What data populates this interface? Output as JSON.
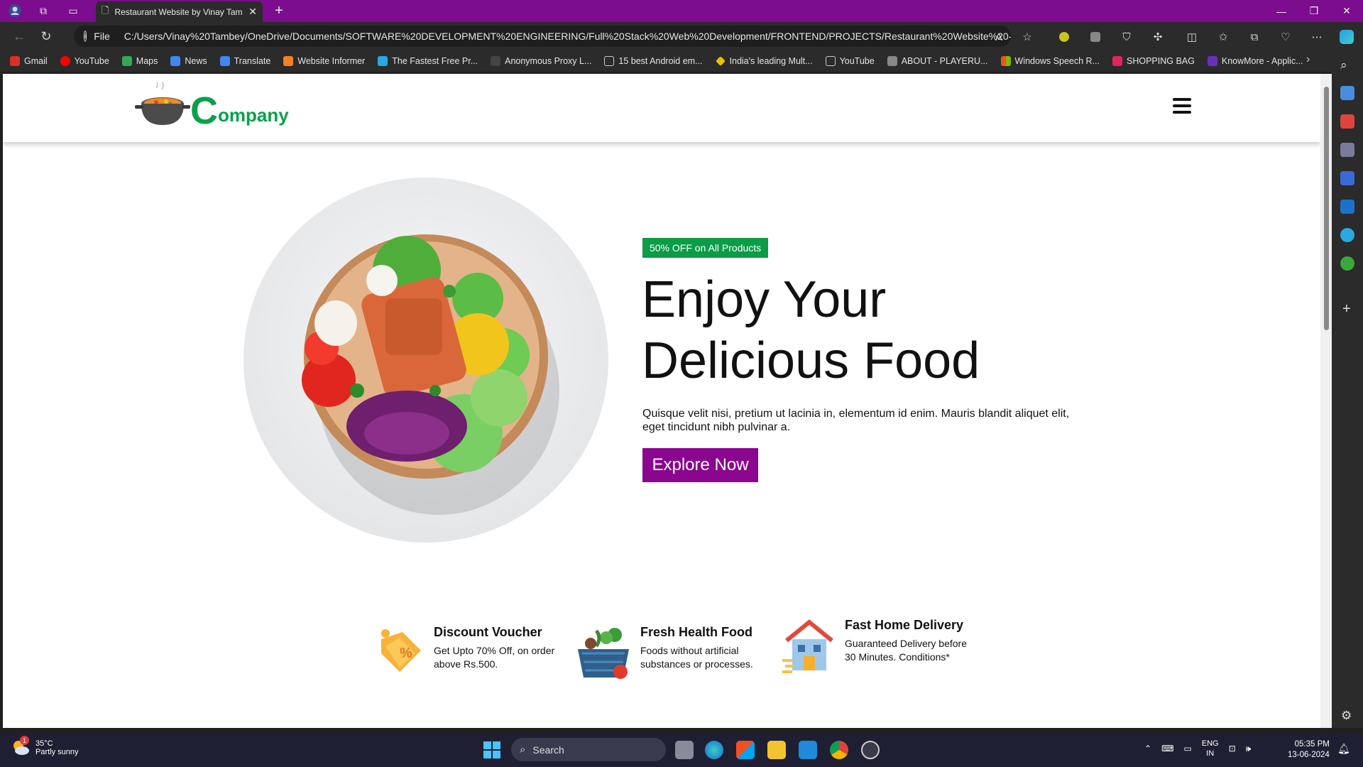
{
  "browser": {
    "tab_title": "Restaurant Website by Vinay Tam",
    "url_scheme": "File",
    "url": "C:/Users/Vinay%20Tambey/OneDrive/Documents/SOFTWARE%20DEVELOPMENT%20ENGINEERING/Full%20Stack%20Web%20Development/FRONTEND/PROJECTS/Restaurant%20Website%20-...",
    "bookmarks": [
      {
        "label": "Gmail",
        "color": "#d93025"
      },
      {
        "label": "YouTube",
        "color": "#ff0000"
      },
      {
        "label": "Maps",
        "color": "#34a853"
      },
      {
        "label": "News",
        "color": "#4285f4"
      },
      {
        "label": "Translate",
        "color": "#4285f4"
      },
      {
        "label": "Website Informer",
        "color": "#f48024"
      },
      {
        "label": "The Fastest Free Pr...",
        "color": "#2aa6e0"
      },
      {
        "label": "Anonymous Proxy L...",
        "color": "#444444"
      },
      {
        "label": "15 best Android em...",
        "color": "#cccccc"
      },
      {
        "label": "India's leading Mult...",
        "color": "#e5c100"
      },
      {
        "label": "YouTube",
        "color": "#cccccc"
      },
      {
        "label": "ABOUT - PLAYERU...",
        "color": "#888888"
      },
      {
        "label": "Windows Speech R...",
        "color": "#f25022"
      },
      {
        "label": "SHOPPING BAG",
        "color": "#e0245e"
      },
      {
        "label": "KnowMore - Applic...",
        "color": "#6b2fbf"
      }
    ]
  },
  "site": {
    "logo_first": "C",
    "logo_rest": "ompany",
    "badge": "50% OFF on All Products",
    "hero_line1": "Enjoy Your",
    "hero_line2": "Delicious Food",
    "hero_text": "Quisque velit nisi, pretium ut lacinia in, elementum id enim. Mauris blandit aliquet elit, eget tincidunt nibh pulvinar a.",
    "cta": "Explore Now",
    "features": [
      {
        "title": "Discount Voucher",
        "desc": "Get Upto 70% Off, on order above Rs.500."
      },
      {
        "title": "Fresh Health Food",
        "desc": "Foods without artificial substances or processes."
      },
      {
        "title": "Fast Home Delivery",
        "desc": "Guaranteed Delivery before 30 Minutes. Conditions*"
      }
    ]
  },
  "taskbar": {
    "temp": "35°C",
    "weather": "Partly sunny",
    "weather_badge": "1",
    "search_placeholder": "Search",
    "lang1": "ENG",
    "lang2": "IN",
    "time": "05:35 PM",
    "date": "13-06-2024"
  },
  "colors": {
    "titlebar": "#7b0d8e",
    "brand_green": "#0aa04a",
    "cta_purple": "#8a068f"
  }
}
